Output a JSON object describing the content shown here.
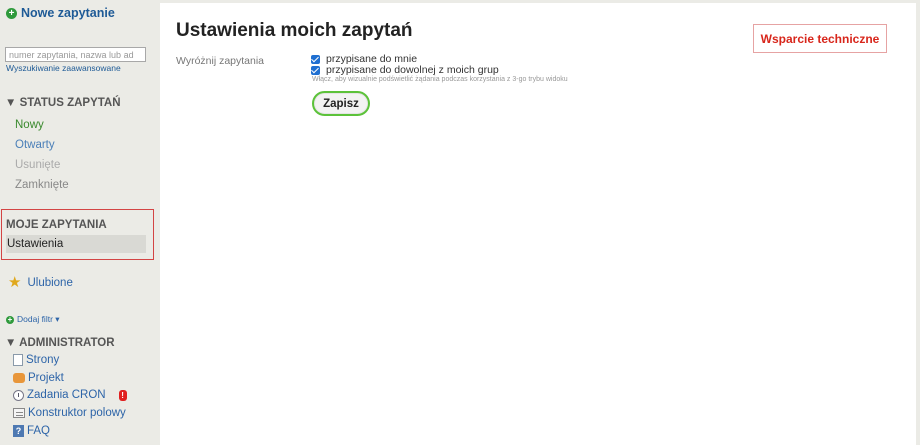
{
  "sidebar": {
    "new_ticket": "Nowe zapytanie",
    "search_placeholder": "numer zapytania, nazwa lub ad",
    "advanced_search": "Wyszukiwanie zaawansowane",
    "status": {
      "heading": "▼ STATUS ZAPYTAŃ",
      "items": [
        "Nowy",
        "Otwarty",
        "Usunięte",
        "Zamknięte"
      ]
    },
    "my_tickets": {
      "heading": "MOJE ZAPYTANIA",
      "settings": "Ustawienia"
    },
    "favorites": "Ulubione",
    "add_filter": "Dodaj filtr ▾",
    "admin": {
      "heading": "▼ ADMINISTRATOR",
      "items": [
        "Strony",
        "Projekt",
        "Zadania CRON",
        "Konstruktor polowy",
        "FAQ"
      ],
      "cron_badge": "!",
      "faq_icon_letter": "?"
    }
  },
  "main": {
    "title": "Ustawienia moich zapytań",
    "support_button": "Wsparcie techniczne",
    "highlight_label": "Wyróżnij zapytania",
    "options": [
      "przypisane do mnie",
      "przypisane do dowolnej z moich grup"
    ],
    "hint": "Włącz, aby wizualnie podświetlić żądania podczas korzystania z 3-go trybu widoku",
    "save_button": "Zapisz"
  },
  "colors": {
    "sidebar_bg": "#ebebe6",
    "link": "#2d64a8",
    "highlight_border": "#d34444",
    "support_red": "#d8261b",
    "save_border": "#5cc23a",
    "checkbox": "#1f6fd1"
  }
}
